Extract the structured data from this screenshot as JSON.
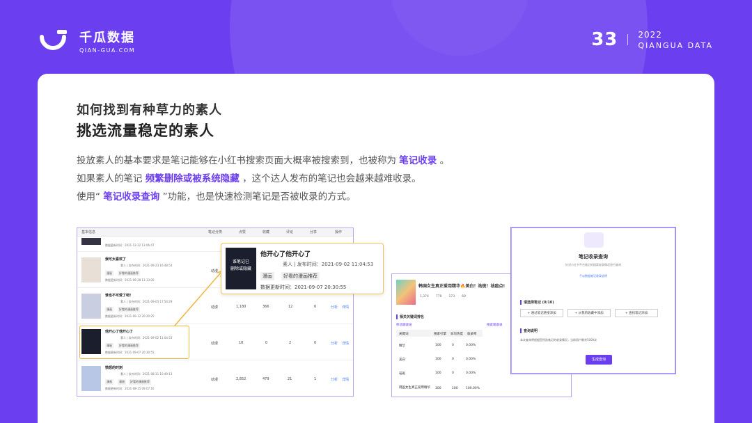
{
  "brand": {
    "name": "千瓜数据",
    "domain": "QIAN-GUA.COM"
  },
  "page": {
    "number": "33",
    "year": "2022",
    "subtitle": "QIANGUA DATA"
  },
  "heading": {
    "line1": "如何找到有种草力的素人",
    "line2": "挑选流量稳定的素人"
  },
  "paragraph": {
    "l1a": "投放素人的基本要求是笔记能够在小红书搜索页面大概率被搜索到，也被称为 ",
    "l1b": "笔记收录",
    "l1c": " 。",
    "l2a": "如果素人的笔记 ",
    "l2b": "频繁删除或被系统隐藏",
    "l2c": " ，这个达人发布的笔记也会越来越难收录。",
    "l3a": "使用“ ",
    "l3b": "笔记收录查询",
    "l3c": " ”功能，也是快速检测笔记是否被收录的方式。"
  },
  "table": {
    "headers": [
      "基本信息",
      "笔记分类",
      "点赞",
      "收藏",
      "评论",
      "分享",
      "操作"
    ],
    "row0_time": "数据更新时间：2021-12-22 13:06:47",
    "rows": [
      {
        "title": "我可太喜欢了",
        "sub": "素人 | 发布时间：2021-09-23 16:48:54",
        "tags": [
          "漫画",
          "好看的漫画推荐"
        ],
        "upd": "数据更新时间：2021-09-28 11:13:00",
        "cat": "动漫",
        "likes": "",
        "fav": "",
        "cmt": "",
        "share": ""
      },
      {
        "title": "谁也不可受了吧!",
        "sub": "素人 | 发布时间：2021-09-05 17:54:29",
        "tags": [
          "漫画",
          "好看的漫画推荐"
        ],
        "upd": "数据更新时间：2021-09-12 20:20:25",
        "cat": "动漫",
        "likes": "1,180",
        "fav": "366",
        "cmt": "12",
        "share": "6"
      },
      {
        "title": "他开心了他开心了",
        "sub": "素人 | 发布时间：2021-09-02 11:04:53",
        "tags": [
          "漫画",
          "好看的漫画推荐"
        ],
        "upd": "数据更新时间：2021-09-07 20:30:55",
        "cat": "动漫",
        "likes": "18",
        "fav": "0",
        "cmt": "2",
        "share": "0"
      },
      {
        "title": "愤怒的时刻",
        "sub": "素人 | 发布时间：2021-08-11 10:49:13",
        "tags": [
          "漫画",
          "漫画",
          "好看的漫画推荐"
        ],
        "upd": "数据更新时间：2021-08-15 09:07:16",
        "cat": "动漫",
        "likes": "2,852",
        "fav": "479",
        "cmt": "21",
        "share": "1"
      }
    ],
    "actions": {
      "analyze": "分析",
      "detail": "详情"
    }
  },
  "popup": {
    "title": "他开心了他开心了",
    "meta": "素人 | 发布时间：2021-09-02 11:04:53",
    "tag1": "漫画",
    "tag2": "好看的漫画推荐",
    "updated": "数据更新时间：2021-09-07 20:30:55",
    "thumb_text": "谁笔记已\n删除或隐藏"
  },
  "mid": {
    "note_title": "韩国女生真正爱用精华🔥美白！祛斑！祛痘点!",
    "stats": [
      "1,374",
      "770",
      "173",
      "60"
    ],
    "section": "相关关键词排名",
    "sub_a": "移动端收录",
    "sub_b": "搜索端收录",
    "col_head": [
      "关键词",
      "搜索引擎",
      "日均热度",
      "收录率"
    ],
    "rows": [
      [
        "精华",
        "100",
        "0",
        "0.00%"
      ],
      [
        "美白",
        "100",
        "0",
        "0.00%"
      ],
      [
        "祛斑",
        "100",
        "0",
        "0.00%"
      ],
      [
        "韩国女生真正爱用精华",
        "100",
        "100",
        "100.00%"
      ]
    ]
  },
  "right": {
    "title": "笔记收录查询",
    "desc": "针对小红书平台笔记的搜索收录情况进行查询",
    "link": "千瓜数据笔记收录说明",
    "section1": "请选择笔记 (0/10)",
    "btns": [
      "+ 通过笔记链接添加",
      "+ 从我的收藏中添加",
      "+ 查找笔记添加"
    ],
    "section2": "查询说明",
    "note": "本次查询将根据您所选笔记的收录情况，当前用户剩余5000次",
    "submit": "生成查询"
  },
  "colors": {
    "accent": "#6b3ff0",
    "highlight": "#f0b63f"
  }
}
